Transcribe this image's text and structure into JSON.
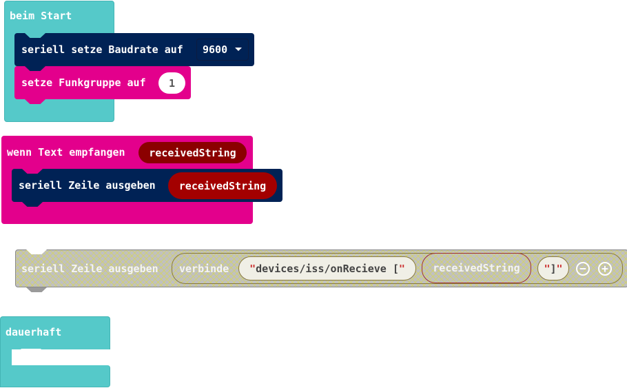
{
  "on_start": {
    "title": "beim Start",
    "baud_label": "seriell setze Baudrate auf",
    "baud_value": "9600",
    "radio_label": "setze Funkgruppe auf",
    "radio_value": "1"
  },
  "on_received": {
    "title": "wenn Text empfangen",
    "param": "receivedString",
    "write_label": "seriell Zeile ausgeben",
    "write_arg": "receivedString"
  },
  "disabled_block": {
    "write_label": "seriell Zeile ausgeben",
    "join_label": "verbinde",
    "str1": "devices/iss/onRecieve [",
    "var": "receivedString",
    "str2": "]",
    "quote": "\""
  },
  "forever": {
    "title": "dauerhaft"
  },
  "colors": {
    "events": "#55c9c9",
    "serial": "#002255",
    "radio": "#e3008c",
    "variable": "#a30000"
  }
}
